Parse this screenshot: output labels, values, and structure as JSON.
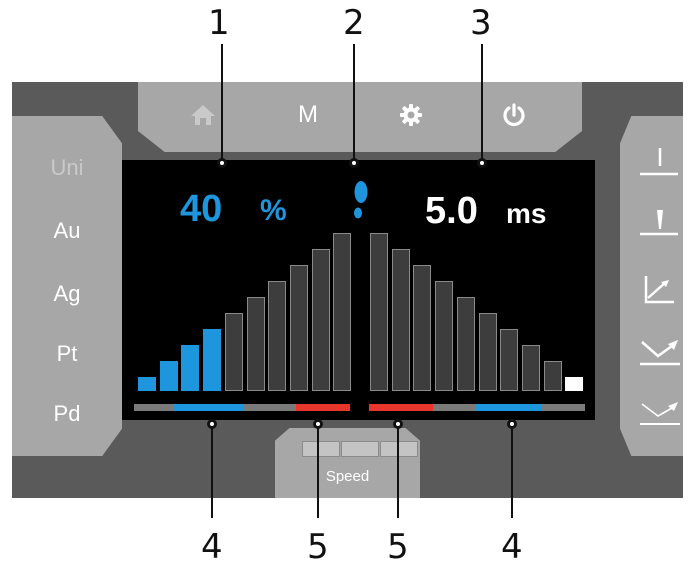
{
  "callouts": {
    "top": [
      "1",
      "2",
      "3"
    ],
    "bottom": [
      "4",
      "5",
      "5",
      "4"
    ]
  },
  "top_bar": {
    "icons": [
      "home-icon",
      "m-mode-icon",
      "gear-icon",
      "power-icon"
    ],
    "m_label": "M"
  },
  "materials": [
    {
      "label": "Uni",
      "active": false
    },
    {
      "label": "Au",
      "active": true
    },
    {
      "label": "Ag",
      "active": true
    },
    {
      "label": "Pt",
      "active": true
    },
    {
      "label": "Pd",
      "active": true
    }
  ],
  "right_modes": [
    "mode-straight-icon",
    "mode-point-icon",
    "mode-corner-icon",
    "mode-v-icon",
    "mode-v-flat-icon"
  ],
  "screen": {
    "power_value": "40",
    "power_unit": "%",
    "pulse_value": "5.0",
    "pulse_unit": "ms",
    "power_level": 0.4,
    "pulse_level": 0.08
  },
  "speed": {
    "label": "Speed",
    "segments": 3
  },
  "colors": {
    "accent_blue": "#1e96de",
    "accent_red": "#e8362d",
    "panel_gray": "#a7a7a7",
    "frame_gray": "#5a5a5a",
    "screen_black": "#000000"
  }
}
